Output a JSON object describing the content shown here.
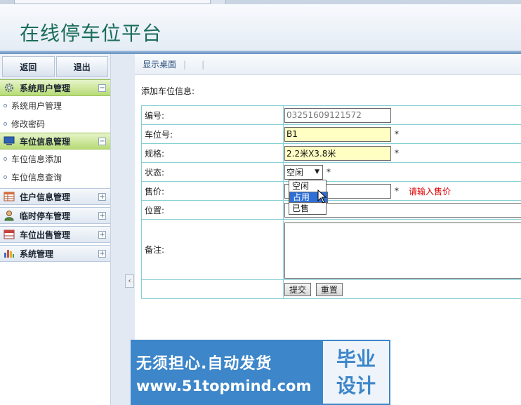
{
  "app": {
    "title": "在线停车位平台"
  },
  "sidebar": {
    "top_buttons": [
      "返回",
      "退出"
    ],
    "groups": [
      {
        "label": "系统用户管理",
        "icon": "gear-icon",
        "expanded": true,
        "items": [
          "系统用户管理",
          "修改密码"
        ]
      },
      {
        "label": "车位信息管理",
        "icon": "monitor-icon",
        "expanded": true,
        "items": [
          "车位信息添加",
          "车位信息查询"
        ]
      },
      {
        "label": "住户信息管理",
        "icon": "table-icon",
        "expanded": false,
        "items": []
      },
      {
        "label": "临时停车管理",
        "icon": "person-icon",
        "expanded": false,
        "items": []
      },
      {
        "label": "车位出售管理",
        "icon": "calendar-icon",
        "expanded": false,
        "items": []
      },
      {
        "label": "系统管理",
        "icon": "bar-chart-icon",
        "expanded": false,
        "items": []
      }
    ],
    "collapse_glyph": "‹"
  },
  "main": {
    "tab_label": "显示桌面",
    "form_title": "添加车位信息:",
    "fields": [
      {
        "label": "编号:",
        "value": "03251609121572"
      },
      {
        "label": "车位号:",
        "value": "B1",
        "required": "*"
      },
      {
        "label": "规格:",
        "value": "2.2米X3.8米",
        "required": "*"
      },
      {
        "label": "状态:",
        "value": "空闲",
        "required": "*"
      },
      {
        "label": "售价:",
        "value": "",
        "required": "*",
        "hint": "请输入售价"
      },
      {
        "label": "位置:",
        "value": ""
      },
      {
        "label": "备注:",
        "value": ""
      }
    ],
    "status_options": [
      "空闲",
      "占用",
      "已售"
    ],
    "highlighted_option": "占用",
    "buttons": {
      "submit": "提交",
      "reset": "重置"
    }
  },
  "watermark": {
    "line1": "无须担心.自动发货",
    "line2": "www.51topmind.com",
    "badge1": "毕业",
    "badge2": "设计"
  },
  "colors": {
    "accent_green": "#b7db76",
    "title_green": "#1a6d5a",
    "table_border": "#86d0d6",
    "highlight_blue": "#2f6fd6",
    "watermark_blue": "#3d86c9",
    "hint_red": "#dd0000"
  }
}
